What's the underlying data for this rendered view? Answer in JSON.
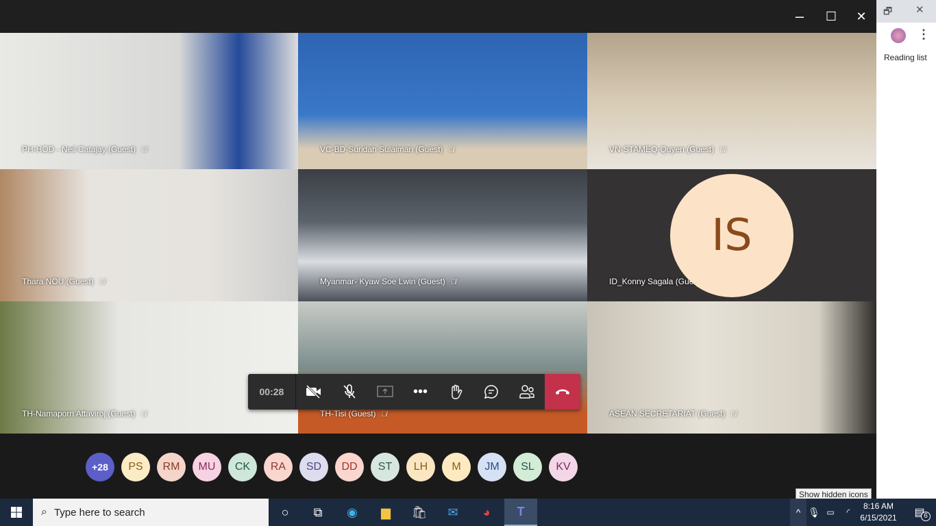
{
  "window": {
    "restore": "🗗",
    "maximize": "☐",
    "close": "✕"
  },
  "tiles": [
    {
      "name": "PH-HOD - Neil Catajay (Guest)",
      "bg": "linear-gradient(90deg,#e9e9e6,#d8d8d6 60%,#254a9a 80%,#ddd)"
    },
    {
      "name": "VC-BD-Suridah Sulaiman (Guest)",
      "bg": "linear-gradient(180deg,#2d64b3,#3a78c8 60%,#d9cbb4 85%)"
    },
    {
      "name": "VN-STAMEQ-Quyen (Guest)",
      "bg": "linear-gradient(180deg,#b3a38b,#d8cbb5 50%,#e8e4dd)"
    },
    {
      "name": "Thara NOU (Guest)",
      "bg": "linear-gradient(90deg,#b08865,#e7e4df 30%,#e6e3de 70%,#ccc)"
    },
    {
      "name": "Myanmar- Kyaw Soe Lwin (Guest)",
      "bg": "linear-gradient(180deg,#3b3f45,#5c636b 40%,#d9dde2 70%,#4b5058)"
    },
    {
      "name": "ID_Konny Sagala (Guest)",
      "bg": "#343232"
    },
    {
      "name": "TH-Namaporn Attaviroj (Guest)",
      "bg": "linear-gradient(90deg,#6d7a46,#e6e6e3 40%,#efefec)"
    },
    {
      "name": "TH-Tisi (Guest)",
      "bg": "linear-gradient(180deg,#c8cbc6,#7c8e8c 50%,#c65a26 85%)"
    },
    {
      "name": "ASEAN SECRETARIAT (Guest)",
      "bg": "linear-gradient(90deg,#c9c3b7,#e6e1d6 40%,#d6d0c4 80%,#2f2d2b)"
    }
  ],
  "konny_initials": "IS",
  "call": {
    "timer": "00:28",
    "camera_off": "camera-off",
    "mic_off": "mic-off",
    "share": "share",
    "more": "•••",
    "raise_hand": "✋",
    "chat": "💬",
    "people": "👥",
    "hangup": "hang-up"
  },
  "roster": [
    {
      "label": "+28",
      "bg": "#5b5fc7",
      "fg": "#ffffff"
    },
    {
      "label": "PS",
      "bg": "#fbecc5",
      "fg": "#8a5c1a"
    },
    {
      "label": "RM",
      "bg": "#f5d5ca",
      "fg": "#8a3a2a"
    },
    {
      "label": "MU",
      "bg": "#f6d3e3",
      "fg": "#8a2c58"
    },
    {
      "label": "CK",
      "bg": "#cfe6da",
      "fg": "#1f5a3e"
    },
    {
      "label": "RA",
      "bg": "#fad6cf",
      "fg": "#8a3a2a"
    },
    {
      "label": "SD",
      "bg": "#dedcef",
      "fg": "#4a4a80"
    },
    {
      "label": "DD",
      "bg": "#fad6cf",
      "fg": "#a1362a"
    },
    {
      "label": "ST",
      "bg": "#d7e7df",
      "fg": "#2b5a44"
    },
    {
      "label": "LH",
      "bg": "#fbe6c2",
      "fg": "#8a5c1a"
    },
    {
      "label": "M",
      "bg": "#fdeac0",
      "fg": "#8a5c1a"
    },
    {
      "label": "JM",
      "bg": "#d6e2f4",
      "fg": "#2c4c86"
    },
    {
      "label": "SL",
      "bg": "#d3ecd8",
      "fg": "#2b5a44"
    },
    {
      "label": "KV",
      "bg": "#f3d6e8",
      "fg": "#7a2c5a"
    }
  ],
  "browser": {
    "reading_list": "Reading list",
    "menu": "⋮"
  },
  "taskbar": {
    "search_placeholder": "Type here to search",
    "time": "8:16 AM",
    "date": "6/15/2021",
    "notifications": "6",
    "tooltip": "Show hidden icons"
  }
}
